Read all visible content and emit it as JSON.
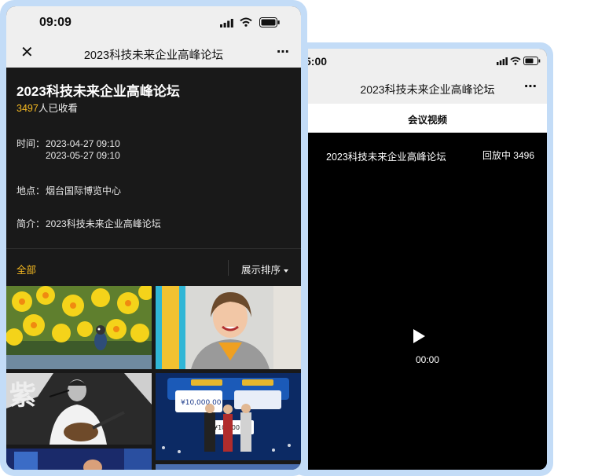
{
  "back_phone": {
    "status_time": "5:00",
    "nav_title": "2023科技未来企业高峰论坛",
    "more_icon": "⋯",
    "tab_label": "会议视频",
    "video": {
      "title": "2023科技未来企业高峰论坛",
      "status": "回放中 3496",
      "elapsed": "00:00"
    }
  },
  "front_phone": {
    "status_time": "09:09",
    "nav_title": "2023科技未来企业高峰论坛",
    "close_icon": "✕",
    "more_icon": "⋯",
    "event": {
      "title": "2023科技未来企业高峰论坛",
      "views_count": "3497",
      "views_suffix": "人已收看",
      "time_label": "时间：",
      "time_start": "2023-04-27 09:10",
      "time_end": "2023-05-27 09:10",
      "place_label": "地点：",
      "place_value": "烟台国际博览中心",
      "intro_label": "简介：",
      "intro_value": "2023科技未来企业高峰论坛"
    },
    "filter": {
      "all_label": "全部",
      "sort_label": "展示排序"
    },
    "photos": [
      {
        "subject": "daffodils-with-bird"
      },
      {
        "subject": "smiling-woman"
      },
      {
        "subject": "guitarist-singer"
      },
      {
        "subject": "award-ceremony"
      },
      {
        "subject": "stage-lights"
      },
      {
        "subject": "stage-crowd"
      }
    ]
  },
  "colors": {
    "accent": "#f5b921",
    "frame": "#c3dcf7",
    "dark_bg": "#191919",
    "video_bg": "#000000"
  }
}
